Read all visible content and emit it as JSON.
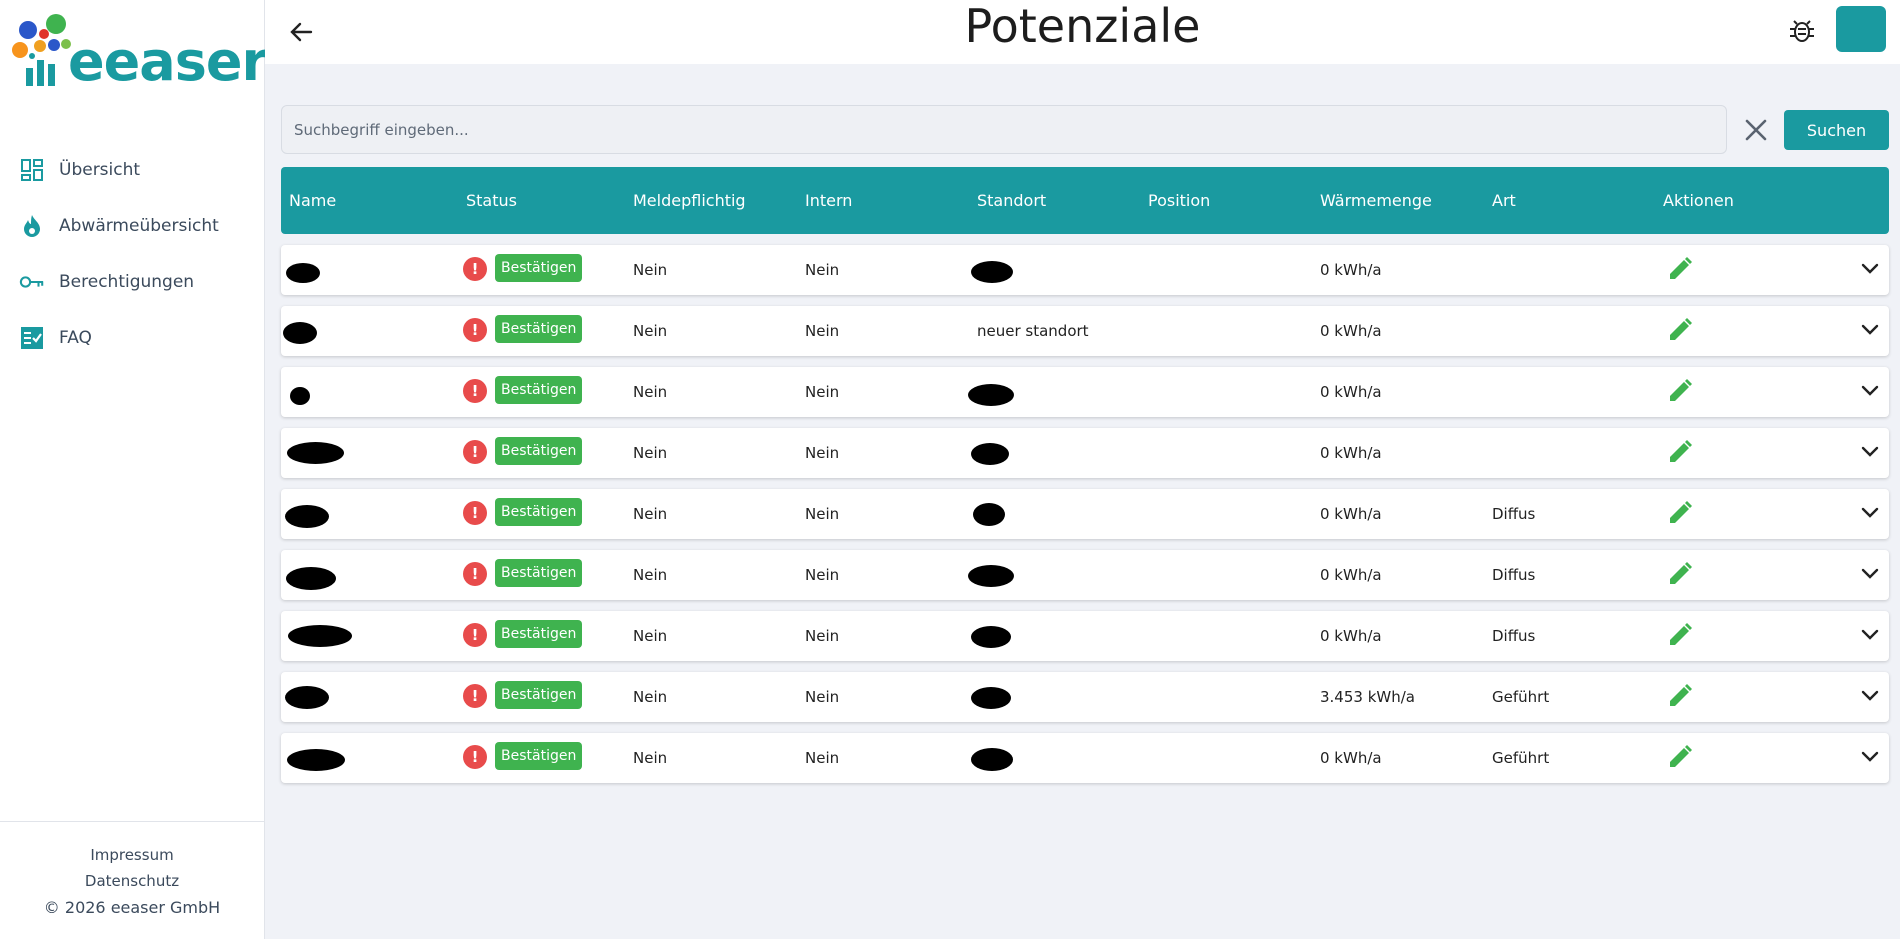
{
  "brand": {
    "name": "eeaser",
    "accent": "#1a9aa0",
    "success": "#3fb34f",
    "danger": "#e84b4b"
  },
  "header": {
    "title": "Potenziale",
    "back_icon": "arrow-left-icon",
    "bug_icon": "bug-icon"
  },
  "sidebar": {
    "items": [
      {
        "label": "Übersicht",
        "icon": "dashboard-icon"
      },
      {
        "label": "Abwärmeübersicht",
        "icon": "flame-icon"
      },
      {
        "label": "Berechtigungen",
        "icon": "key-icon"
      },
      {
        "label": "FAQ",
        "icon": "checklist-icon"
      }
    ],
    "footer": {
      "impressum": "Impressum",
      "datenschutz": "Datenschutz",
      "copyright": "© 2026 eeaser GmbH"
    }
  },
  "search": {
    "placeholder": "Suchbegriff eingeben...",
    "value": "",
    "button_label": "Suchen"
  },
  "table": {
    "columns": [
      "Name",
      "Status",
      "Meldepflichtig",
      "Intern",
      "Standort",
      "Position",
      "Wärmemenge",
      "Art",
      "Aktionen"
    ],
    "rows": [
      {
        "status": "Bestätigen",
        "meldepflichtig": "Nein",
        "intern": "Nein",
        "standort": "",
        "position": "",
        "waermemenge": "0  kWh/a",
        "art": ""
      },
      {
        "status": "Bestätigen",
        "meldepflichtig": "Nein",
        "intern": "Nein",
        "standort": "neuer standort",
        "position": "",
        "waermemenge": "0  kWh/a",
        "art": ""
      },
      {
        "status": "Bestätigen",
        "meldepflichtig": "Nein",
        "intern": "Nein",
        "standort": "",
        "position": "",
        "waermemenge": "0  kWh/a",
        "art": ""
      },
      {
        "status": "Bestätigen",
        "meldepflichtig": "Nein",
        "intern": "Nein",
        "standort": "",
        "position": "",
        "waermemenge": "0  kWh/a",
        "art": ""
      },
      {
        "status": "Bestätigen",
        "meldepflichtig": "Nein",
        "intern": "Nein",
        "standort": "",
        "position": "",
        "waermemenge": "0  kWh/a",
        "art": "Diffus"
      },
      {
        "status": "Bestätigen",
        "meldepflichtig": "Nein",
        "intern": "Nein",
        "standort": "",
        "position": "",
        "waermemenge": "0  kWh/a",
        "art": "Diffus"
      },
      {
        "status": "Bestätigen",
        "meldepflichtig": "Nein",
        "intern": "Nein",
        "standort": "",
        "position": "",
        "waermemenge": "0  kWh/a",
        "art": "Diffus"
      },
      {
        "status": "Bestätigen",
        "meldepflichtig": "Nein",
        "intern": "Nein",
        "standort": "",
        "position": "",
        "waermemenge": "3.453  kWh/a",
        "art": "Geführt"
      },
      {
        "status": "Bestätigen",
        "meldepflichtig": "Nein",
        "intern": "Nein",
        "standort": "",
        "position": "",
        "waermemenge": "0  kWh/a",
        "art": "Geführt"
      }
    ]
  }
}
